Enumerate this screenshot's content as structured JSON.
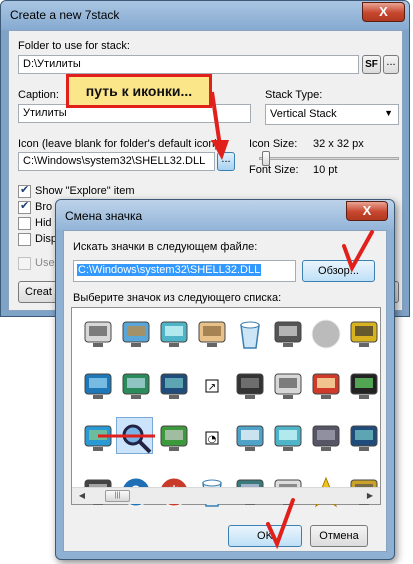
{
  "back_window": {
    "title": "Create a new 7stack",
    "close_glyph": "X",
    "folder_label": "Folder to use for stack:",
    "folder_value": "D:\\Утилиты",
    "sf_button": "SF",
    "browse_glyph": "...",
    "caption_label": "Caption:",
    "caption_value": "Утилиты",
    "stack_type_label": "Stack Type:",
    "stack_type_value": "Vertical Stack",
    "icon_label": "Icon (leave blank for folder's default icon):",
    "icon_value": "C:\\Windows\\system32\\SHELL32.DLL",
    "icon_browse_glyph": "...",
    "icon_size_label": "Icon Size:",
    "icon_size_value": "32 x 32 px",
    "font_size_label": "Font Size:",
    "font_size_value": "10 pt",
    "checkboxes": [
      {
        "label": "Show \"Explore\" item",
        "checked": true
      },
      {
        "label": "Bro",
        "checked": true
      },
      {
        "label": "Hid",
        "checked": false
      },
      {
        "label": "Disp",
        "checked": false
      },
      {
        "label": "Use",
        "checked": false
      }
    ],
    "create_button": "Creat"
  },
  "callout": {
    "text": "путь к иконки..."
  },
  "dialog": {
    "title": "Смена значка",
    "close_glyph": "X",
    "search_label": "Искать значки в следующем файле:",
    "file_value": "C:\\Windows\\system32\\SHELL32.DLL",
    "browse_button": "Обзор...",
    "choose_label": "Выберите значок из следующего списка:",
    "ok_button": "OK",
    "cancel_button": "Отмена",
    "icons": [
      "printer-icon",
      "globe-network-icon",
      "screen-icon",
      "hand-icon",
      "recycle-bin-icon",
      "calculator-icon",
      "cd-icon",
      "key-icon",
      "monitor-icon",
      "tablet-icon",
      "network-icon",
      "shortcut-icon",
      "laptop-icon",
      "printer-icon",
      "media-icon",
      "tower-icon",
      "windows-icon",
      "search-icon",
      "usb-icon",
      "clock-icon",
      "ok-icon",
      "screen-icon",
      "drive-icon",
      "network-icon",
      "control-panel-icon",
      "help-icon",
      "power-icon",
      "empty-bin-icon",
      "network-share-icon",
      "building-icon",
      "star-icon",
      "lock-icon"
    ]
  },
  "colors": {
    "callout_bg": "#fbe68a",
    "annotation_red": "#e2201b",
    "selection_blue": "#3399ff"
  }
}
